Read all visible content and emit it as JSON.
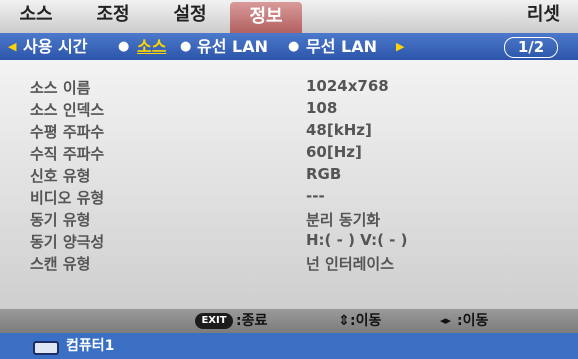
{
  "menu": {
    "tabs": [
      "소스",
      "조정",
      "설정",
      "정보"
    ],
    "reset_label": "리셋"
  },
  "submenu": {
    "items": [
      "사용 시간",
      "소스",
      "유선 LAN",
      "무선 LAN"
    ],
    "page_indicator": "1/2",
    "left_arrow": "◀",
    "right_arrow": "▶",
    "separator": "●"
  },
  "info": {
    "rows": [
      {
        "label": "소스 이름",
        "value": "1024x768"
      },
      {
        "label": "소스 인덱스",
        "value": "108"
      },
      {
        "label": "수평 주파수",
        "value": "48[kHz]"
      },
      {
        "label": "수직 주파수",
        "value": "60[Hz]"
      },
      {
        "label": "신호 유형",
        "value": "RGB"
      },
      {
        "label": "비디오 유형",
        "value": "---"
      },
      {
        "label": "동기 유형",
        "value": "분리 동기화"
      },
      {
        "label": "동기 양극성",
        "value": "H:( - ) V:( - )"
      },
      {
        "label": "스캔 유형",
        "value": "넌 인터레이스"
      }
    ]
  },
  "footer": {
    "exit_badge": "EXIT",
    "exit_label": ":종료",
    "move_vertical_icon": "⇕",
    "move_vertical_label": ":이동",
    "move_horizontal_icon": "◂▸",
    "move_horizontal_label": ":이동"
  },
  "status": {
    "input_label": "컴퓨터1",
    "icon": "computer-input-icon"
  },
  "colors": {
    "active_tab": "#b25f5f",
    "submenu_bar": "#2c55a9",
    "highlight": "#ffd400",
    "status_bar": "#3a6fc4"
  }
}
